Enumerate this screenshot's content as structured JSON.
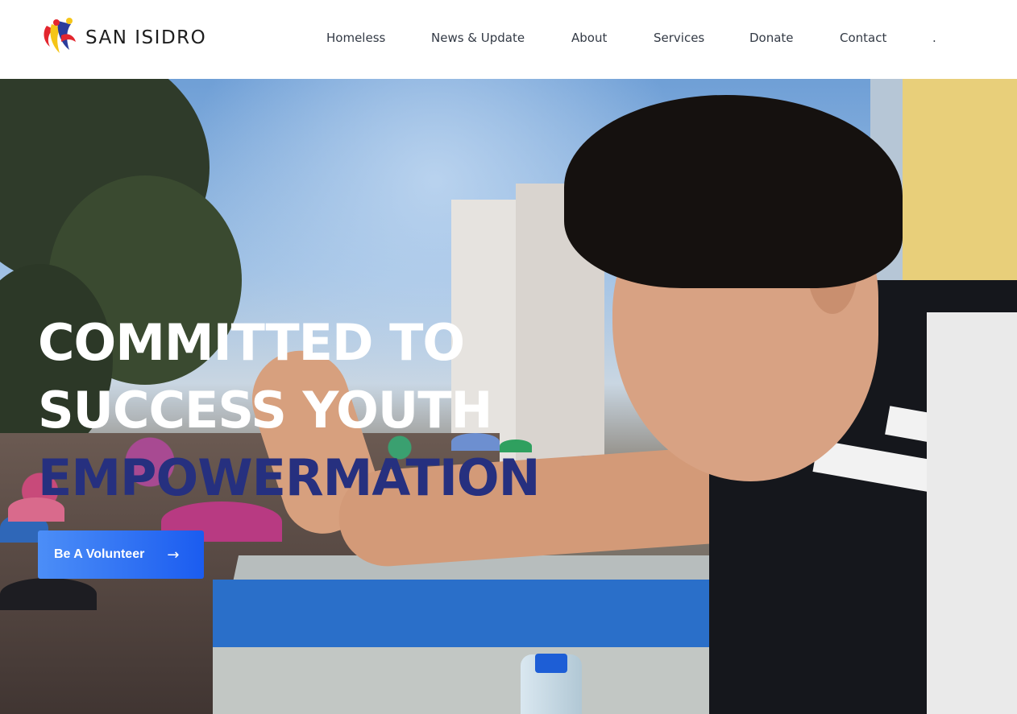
{
  "brand": {
    "name": "SAN ISIDRO",
    "logo_colors": [
      "#e3262e",
      "#f5c518",
      "#2a3c9c"
    ]
  },
  "nav": {
    "items": [
      {
        "label": "Homeless"
      },
      {
        "label": "News & Update"
      },
      {
        "label": "About"
      },
      {
        "label": "Services"
      },
      {
        "label": "Donate"
      },
      {
        "label": "Contact"
      },
      {
        "label": "."
      }
    ]
  },
  "hero": {
    "headline_line1": "COMMITTED TO",
    "headline_line2": "SUCCESS YOUTH",
    "headline_accent": "EMPOWERMATION",
    "accent_color": "#26307f",
    "cta_label": "Be A Volunteer",
    "cta_icon": "arrow-right-icon",
    "cta_color": "#1b5cf0"
  }
}
